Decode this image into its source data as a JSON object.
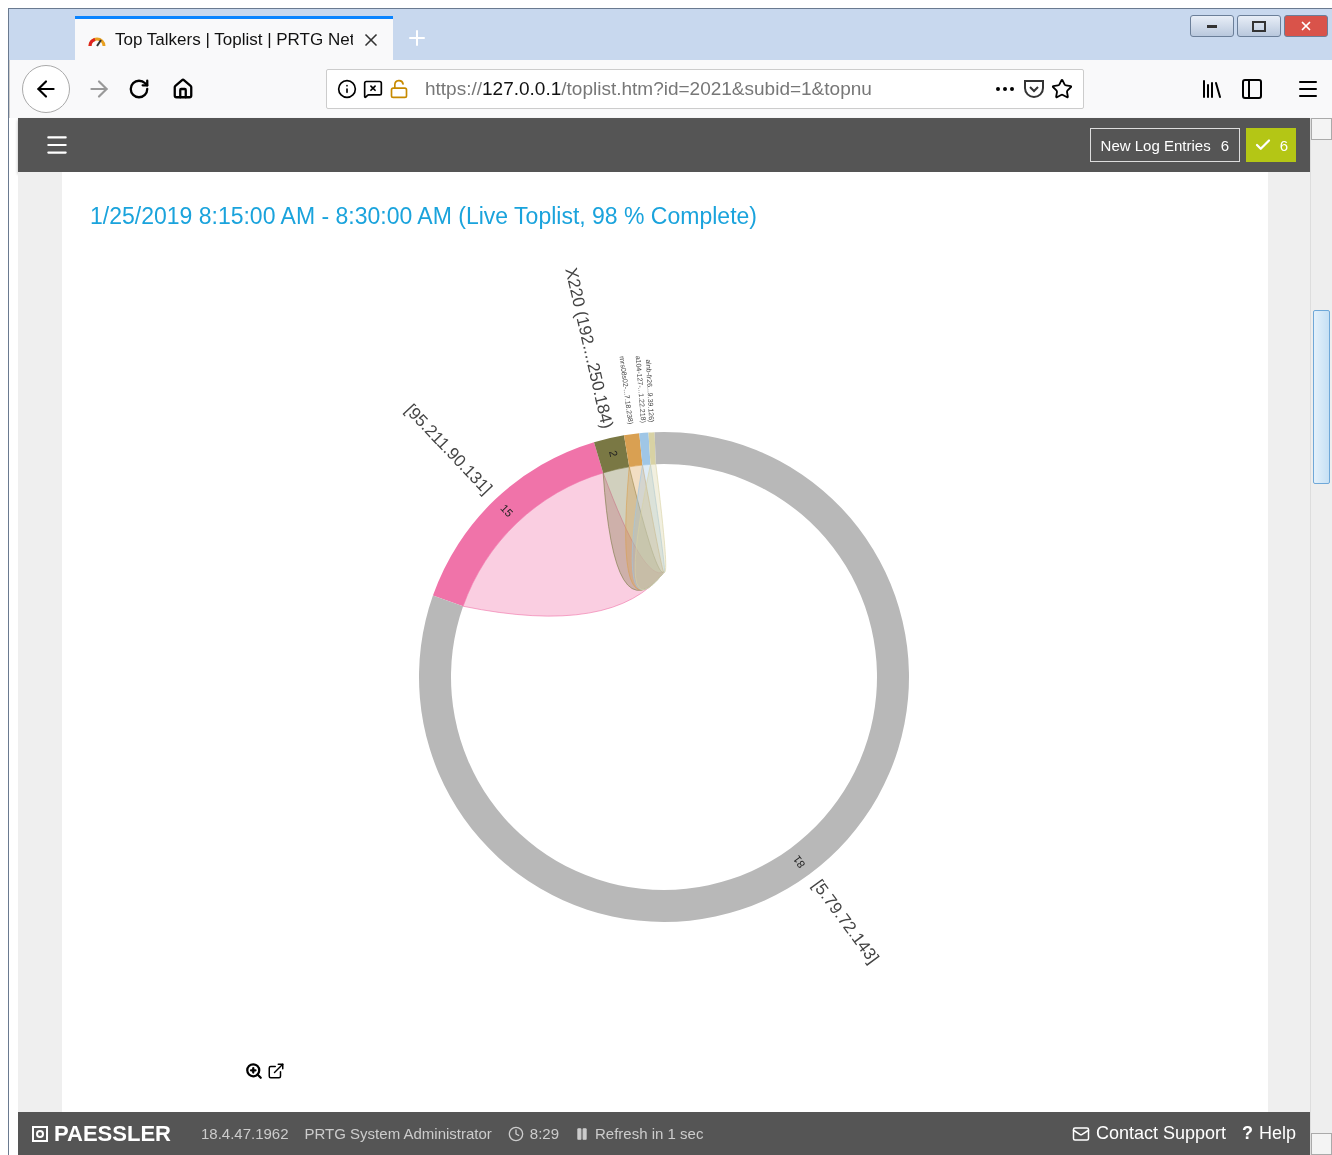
{
  "browser": {
    "tab": {
      "title": "Top Talkers | Toplist | PRTG Net",
      "selected": true
    },
    "url": {
      "prefix": "https://",
      "host": "127.0.0.1",
      "path": "/toplist.htm?id=2021&subid=1&topnu"
    }
  },
  "app_header": {
    "log_button": {
      "label": "New Log Entries",
      "count": "6"
    },
    "ok_badge": {
      "count": "6"
    }
  },
  "toplist": {
    "title": "1/25/2019 8:15:00 AM - 8:30:00 AM (Live Toplist, 98 % Complete)",
    "chart_data": {
      "type": "donut",
      "value_labels": [
        "15",
        "2",
        null,
        null,
        null,
        "81"
      ],
      "categories": [
        "[95.211.90.131]",
        "X220 (192....250.184)",
        "mrs08s02-...7.18.238)",
        "a104-127-...1.22.218)",
        "alnb-fr26...9.39.126)",
        "[5.79.72.143]"
      ],
      "series": [
        {
          "values": [
            15,
            2,
            1,
            0.6,
            0.4,
            81
          ]
        }
      ],
      "colors": [
        "#f073a9",
        "#7a7844",
        "#d9a052",
        "#9fc6e6",
        "#d8d2a4",
        "#b8b8b8"
      ]
    }
  },
  "footer": {
    "brand": "PAESSLER",
    "version": "18.4.47.1962",
    "user": "PRTG System Administrator",
    "time": "8:29",
    "refresh": "Refresh in 1 sec",
    "contact": "Contact Support",
    "help_mark": "?",
    "help": "Help"
  }
}
